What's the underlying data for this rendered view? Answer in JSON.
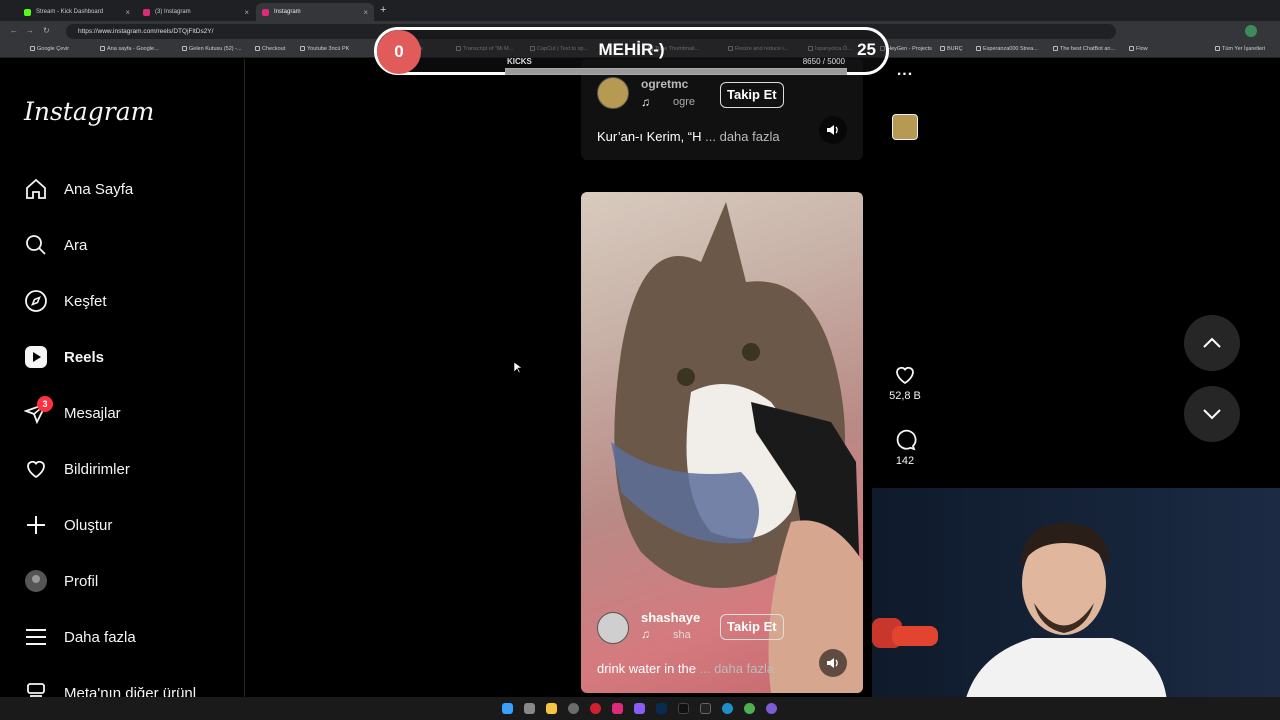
{
  "browser": {
    "tabs": [
      {
        "title": "Stream - Kick Dashboard",
        "color": "#53fc18"
      },
      {
        "title": "(3) Instagram",
        "color": "#dd2a7b"
      },
      {
        "title": "Instagram",
        "color": "#dd2a7b"
      }
    ],
    "new_tab": "+",
    "url": "https://www.instagram.com/reels/DTQjFltDs2Y/",
    "bookmarks": [
      "Google Çevir",
      "Ana sayfa - Google...",
      "Gelen Kutusu (52) -...",
      "Checkout",
      "Youtube 3ncü PK",
      "ing Örnek",
      "Transcript of \"Mi M...",
      "CapCut | Text to sp...",
      "Tube Thumbnail...",
      "Resize and reduce i...",
      "İspanyolca Ö...",
      "HeyGen - Projects",
      "BURÇ",
      "Esperanza000 Strea...",
      "The best ChatBot an...",
      "Flow",
      "Tüm Yer İşaretleri"
    ]
  },
  "sidebar": {
    "logo": "Instagram",
    "items": [
      {
        "label": "Ana Sayfa",
        "icon": "home-icon"
      },
      {
        "label": "Ara",
        "icon": "search-icon"
      },
      {
        "label": "Keşfet",
        "icon": "compass-icon"
      },
      {
        "label": "Reels",
        "icon": "reels-icon"
      },
      {
        "label": "Mesajlar",
        "icon": "messenger-icon",
        "badge": "3"
      },
      {
        "label": "Bildirimler",
        "icon": "heart-icon"
      },
      {
        "label": "Oluştur",
        "icon": "plus-icon"
      },
      {
        "label": "Profil",
        "icon": "avatar-icon"
      },
      {
        "label": "Daha fazla",
        "icon": "menu-icon"
      },
      {
        "label": "Meta'nın diğer ürünl",
        "icon": "meta-icon"
      }
    ]
  },
  "reels": [
    {
      "username": "ogretmc",
      "audio": "ogre",
      "follow": "Takip Et",
      "caption": "Kur’an-ı Kerim, “H",
      "more": "... daha fazla"
    },
    {
      "username": "shashaye",
      "audio": "sha",
      "follow": "Takip Et",
      "caption": "drink water in the",
      "more": "... daha fazla"
    }
  ],
  "actions": {
    "likes": "52,8 B",
    "comments": "142",
    "more": "..."
  },
  "overlay": {
    "left_count": "0",
    "title": "MEHİR-)",
    "right_count": "25",
    "kicks_label": "KICKS",
    "kicks_value": "8650 / 5000",
    "kicks_progress": 1.0
  },
  "colors": {
    "accent_red": "#ff3040",
    "overlay_red": "#e25b5b",
    "kick_green": "#53fc18"
  }
}
